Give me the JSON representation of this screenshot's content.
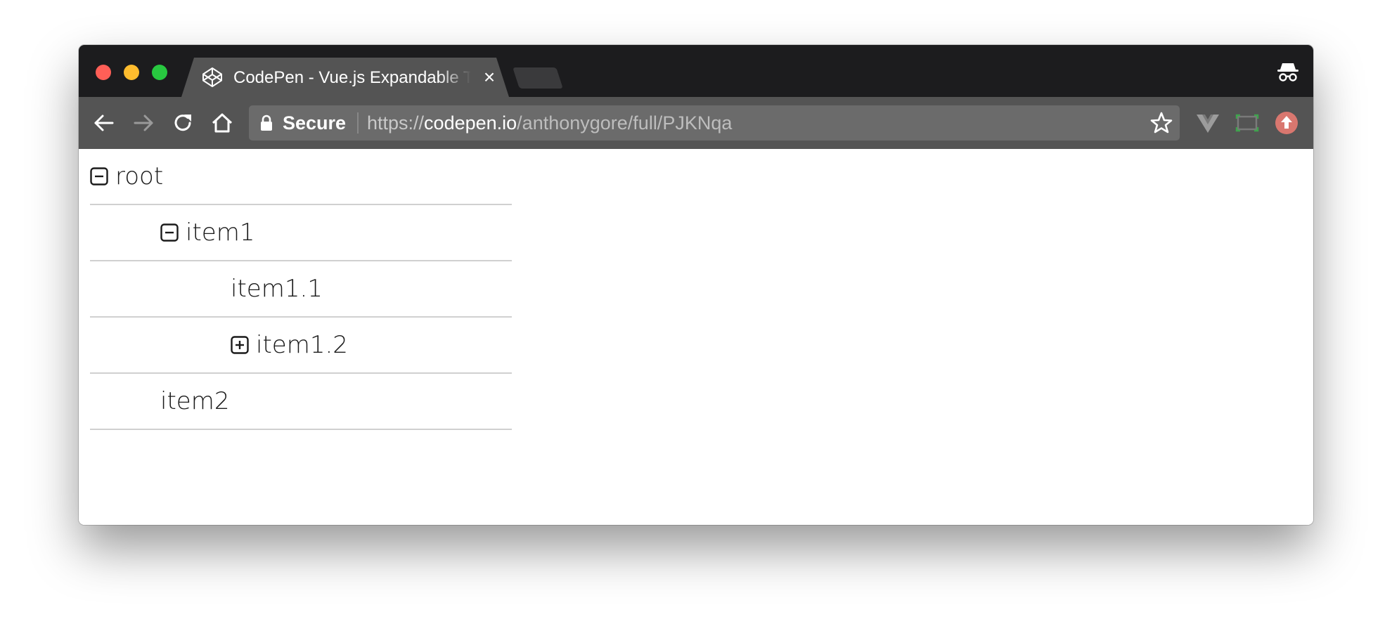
{
  "browser": {
    "tab": {
      "title": "CodePen - Vue.js Expandable Tree",
      "close_glyph": "×",
      "favicon": "codepen-icon"
    },
    "omnibox": {
      "secure_label": "Secure",
      "url_scheme": "https://",
      "url_host": "codepen.io",
      "url_path": "/anthonygore/full/PJKNqa"
    },
    "toolbar_icons": [
      "back-icon",
      "forward-icon",
      "reload-icon",
      "home-icon",
      "star-icon"
    ],
    "extension_icons": [
      "vue-devtools-icon",
      "screen-capture-icon",
      "upload-icon"
    ],
    "profile_icon": "incognito-icon",
    "colors": {
      "titlebar": "#1c1c1e",
      "toolbar": "#545454",
      "omnibox": "#6b6b6b",
      "traffic_red": "#ff5f57",
      "traffic_yellow": "#febc2e",
      "traffic_green": "#28c840",
      "row_divider": "#d0d0d0"
    }
  },
  "tree": {
    "rows": [
      {
        "label": "root",
        "toggle": "minus-box-icon",
        "expanded": true
      },
      {
        "label": "item1",
        "toggle": "minus-box-icon",
        "expanded": true
      },
      {
        "label": "item1.1",
        "toggle": "none"
      },
      {
        "label": "item1.2",
        "toggle": "plus-box-icon",
        "expanded": false
      },
      {
        "label": "item2",
        "toggle": "none"
      }
    ]
  }
}
